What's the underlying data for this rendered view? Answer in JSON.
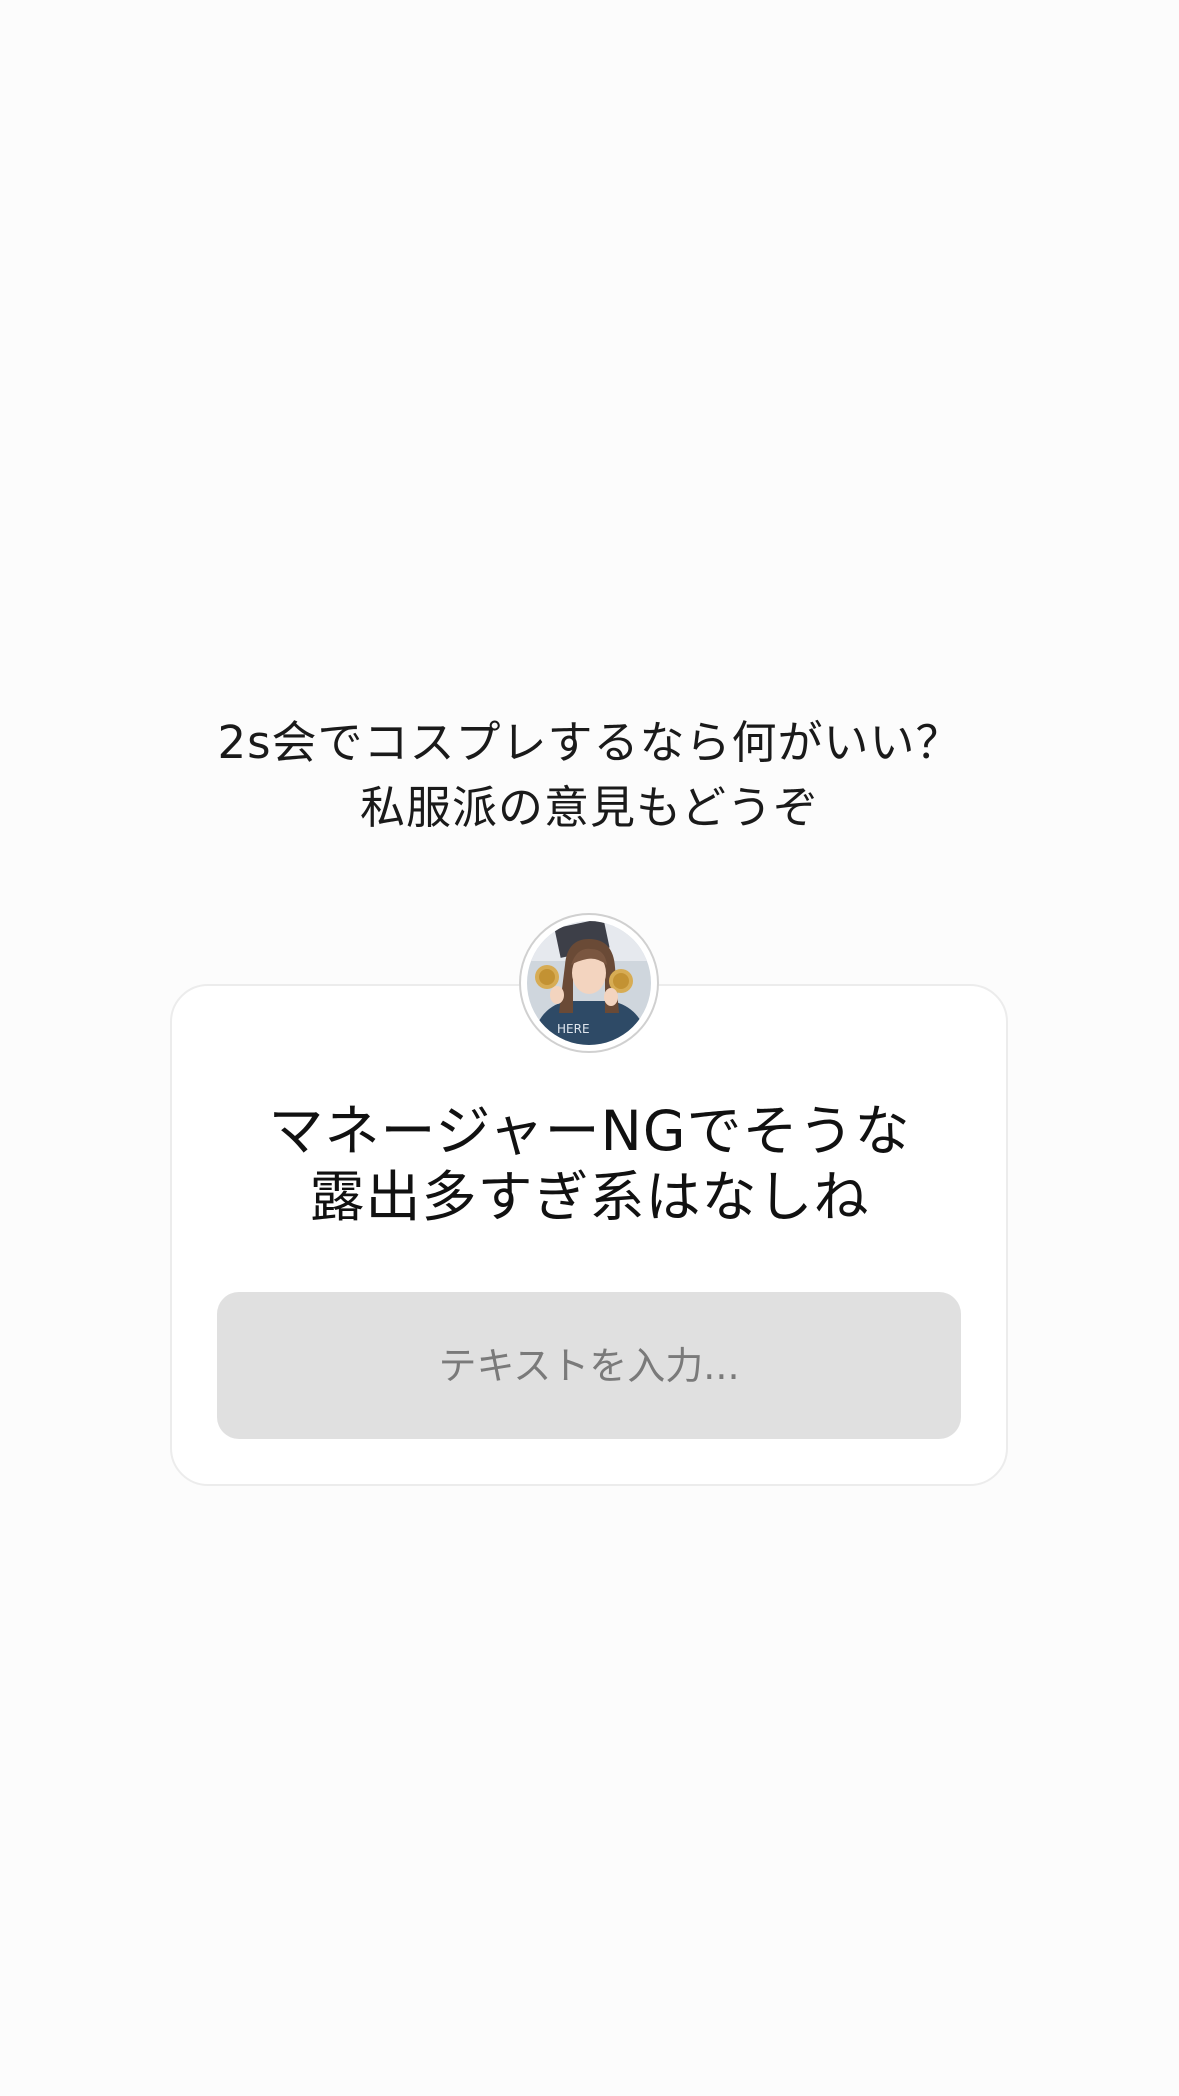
{
  "story": {
    "caption_lines": [
      "2s会でコスプレするなら何がいい？",
      "私服派の意見もどうぞ"
    ]
  },
  "question_sticker": {
    "avatar_icon": "profile-photo",
    "question_lines": [
      "マネージャーNGでそうな",
      "露出多すぎ系はなしね"
    ],
    "input_placeholder": "テキストを入力..."
  },
  "colors": {
    "background": "#fcfcfc",
    "card": "#ffffff",
    "input_bg": "#e0e0e0",
    "text": "#111111",
    "placeholder": "#7a7a7a"
  }
}
